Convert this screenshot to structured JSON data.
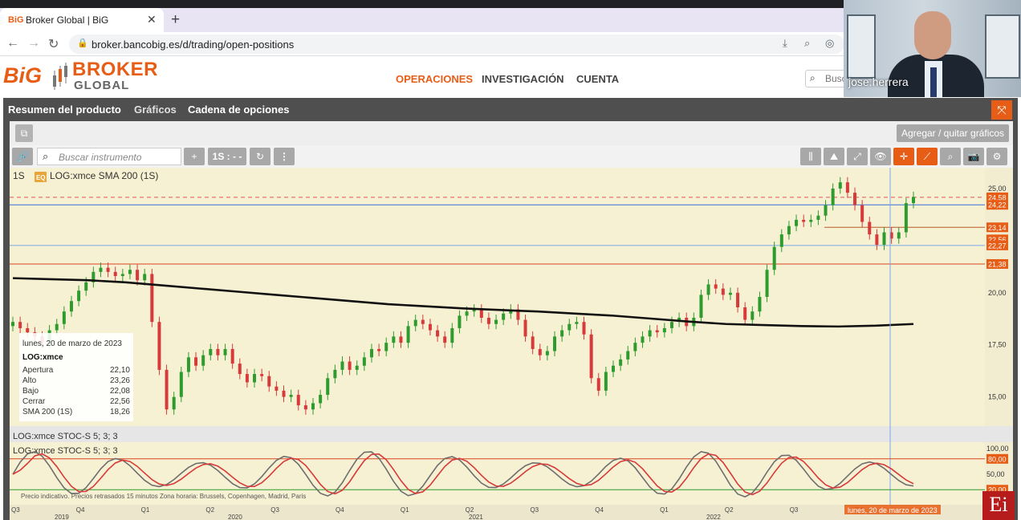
{
  "browser": {
    "tab_title": "Broker Global | BiG",
    "tab_favicon": "BiG",
    "url": "broker.bancobig.es/d/trading/open-positions"
  },
  "site": {
    "logo_big": "BiG",
    "logo_broker": "BROKER",
    "logo_global": "GLOBAL",
    "nav": [
      "OPERACIONES",
      "INVESTIGACIÓN",
      "CUENTA"
    ],
    "search_placeholder": "Busc"
  },
  "video": {
    "name": "jose.herrera"
  },
  "product_tabs": [
    "Resumen del producto",
    "Gráficos",
    "Cadena de opciones"
  ],
  "toolbar": {
    "add_charts": "Agregar / quitar gráficos",
    "search_placeholder": "Buscar instrumento",
    "add": "+",
    "period": "1S : - -",
    "more": "⋮"
  },
  "legend": {
    "period": "1S",
    "badge": "EQ",
    "main_series": "LOG:xmce  SMA 200 (1S)",
    "stoch_a": "LOG:xmce  STOC-S 5; 3; 3",
    "stoch_b": "LOG:xmce  STOC-S 5; 3; 3"
  },
  "infobox": {
    "date": "lunes, 20 de marzo de 2023",
    "symbol": "LOG:xmce",
    "rows": [
      {
        "label": "Apertura",
        "value": "22,10"
      },
      {
        "label": "Alto",
        "value": "23,26"
      },
      {
        "label": "Bajo",
        "value": "22,08"
      },
      {
        "label": "Cerrar",
        "value": "22,56"
      },
      {
        "label": "SMA 200 (1S)",
        "value": "18,26"
      }
    ]
  },
  "footer_note": "Precio indicativo. Precios retrasados 15 minutos    Zona horaria: Brussels, Copenhagen, Madrid, Paris",
  "crosshair_date": "lunes, 20 de marzo de 2023",
  "colors": {
    "accent": "#e85d16",
    "up": "#2e9b2e",
    "down": "#d63a3a",
    "sma": "#111111",
    "chart_bg": "#f7f1d3",
    "hline_blue": "#3a6fd8",
    "hline_red": "#d9441f"
  },
  "chart_data": {
    "type": "candlestick",
    "title": "LOG:xmce",
    "interval": "1S",
    "y_ticks": [
      "25,00",
      "22,50",
      "20,00",
      "17,50",
      "15,00"
    ],
    "ylim": [
      13.6,
      26.0
    ],
    "x_quarters": [
      "Q3",
      "Q4",
      "Q1",
      "Q2",
      "Q3",
      "Q4",
      "Q1",
      "Q2",
      "Q3",
      "Q4",
      "Q1",
      "Q2",
      "Q3",
      "Q4",
      "Q1"
    ],
    "x_years": [
      "2019",
      "2020",
      "2021",
      "2022"
    ],
    "price_tags": [
      {
        "label": "24,58",
        "value": 24.58,
        "color": "#e85d16"
      },
      {
        "label": "24,22",
        "value": 24.22,
        "color": "#e85d16"
      },
      {
        "label": "23,14",
        "value": 23.14,
        "color": "#e85d16"
      },
      {
        "label": "22,56",
        "value": 22.56,
        "color": "#e85d16"
      },
      {
        "label": "22,27",
        "value": 22.27,
        "color": "#e85d16"
      },
      {
        "label": "21,38",
        "value": 21.38,
        "color": "#e85d16"
      }
    ],
    "horizontal_lines": [
      {
        "value": 24.58,
        "color": "#e05a5a",
        "dash": true
      },
      {
        "value": 24.22,
        "color": "#3a6fd8",
        "dash": false
      },
      {
        "value": 22.27,
        "color": "#7aa8e8",
        "dash": false
      },
      {
        "value": 21.38,
        "color": "#d9441f",
        "dash": false
      },
      {
        "value": 23.14,
        "color": "#b75a2a",
        "dash": false,
        "partial": true
      }
    ],
    "close_series": [
      18.6,
      18.3,
      18.1,
      17.9,
      17.6,
      18.2,
      18.5,
      19.1,
      19.6,
      20.1,
      20.5,
      21.0,
      21.2,
      21.0,
      20.8,
      20.9,
      21.1,
      20.6,
      20.9,
      18.6,
      16.3,
      14.4,
      15.0,
      16.2,
      16.9,
      16.5,
      17.0,
      17.3,
      17.0,
      17.3,
      16.6,
      16.1,
      15.7,
      16.1,
      16.0,
      15.5,
      15.3,
      15.0,
      15.1,
      14.6,
      14.4,
      14.7,
      15.1,
      15.9,
      16.3,
      16.7,
      16.3,
      16.5,
      16.9,
      17.3,
      17.2,
      17.6,
      17.9,
      17.6,
      18.4,
      18.7,
      18.5,
      18.2,
      17.9,
      17.6,
      18.3,
      18.9,
      19.1,
      19.2,
      18.8,
      18.5,
      18.7,
      19.0,
      19.2,
      18.7,
      17.9,
      17.3,
      17.0,
      17.2,
      17.9,
      18.2,
      18.5,
      18.6,
      18.0,
      15.9,
      15.3,
      16.2,
      16.5,
      16.8,
      17.2,
      17.6,
      17.9,
      18.2,
      18.1,
      18.3,
      18.6,
      18.8,
      18.4,
      18.8,
      19.9,
      20.4,
      20.2,
      19.9,
      20.0,
      19.3,
      18.7,
      19.1,
      19.8,
      21.1,
      22.2,
      22.8,
      23.2,
      23.5,
      23.4,
      23.5,
      23.7,
      24.2,
      25.0,
      25.3,
      24.8,
      24.2,
      23.4,
      22.8,
      22.3,
      22.9,
      22.6,
      22.9,
      24.3,
      24.6
    ],
    "sma_200": [
      20.7,
      20.65,
      20.6,
      20.5,
      20.35,
      20.2,
      20.05,
      19.9,
      19.75,
      19.6,
      19.45,
      19.35,
      19.25,
      19.17,
      19.1,
      19.0,
      18.9,
      18.76,
      18.62,
      18.5,
      18.45,
      18.4,
      18.38,
      18.42,
      18.5
    ],
    "stochastic": {
      "name": "STOC-S 5; 3; 3",
      "levels": [
        80,
        20
      ],
      "y_ticks": [
        "100,00",
        "50,00",
        "0,00"
      ],
      "level_labels": [
        "80,00",
        "20,00"
      ]
    }
  }
}
